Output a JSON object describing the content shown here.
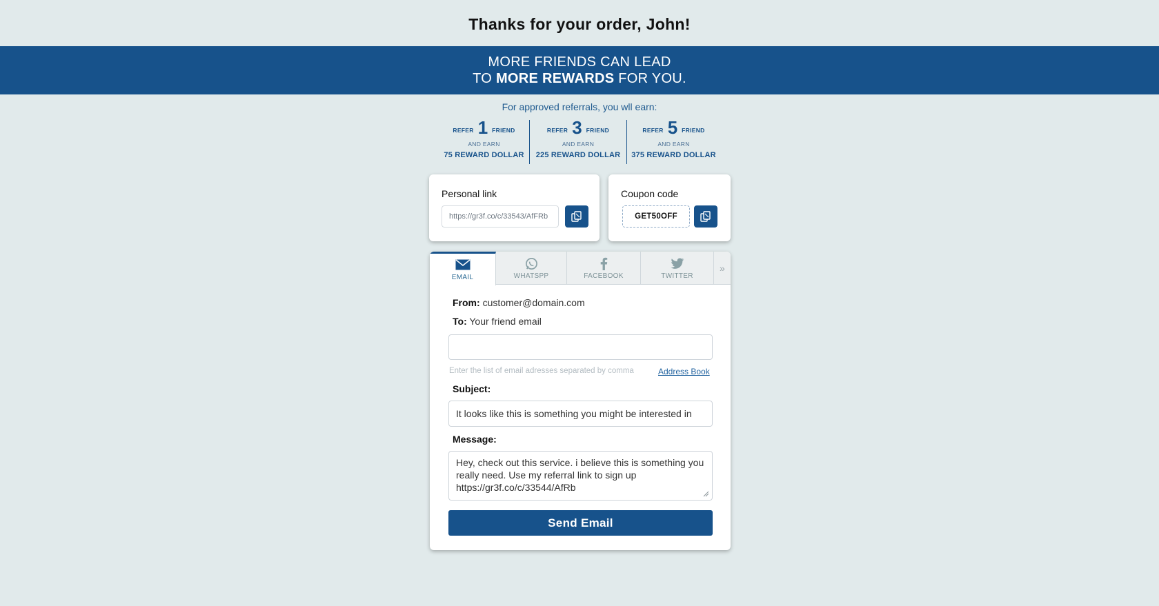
{
  "header": {
    "title": "Thanks for your order, John!"
  },
  "banner": {
    "line1": "MORE FRIENDS CAN LEAD",
    "line2_prefix": "TO ",
    "line2_bold": "MORE REWARDS",
    "line2_suffix": " FOR YOU."
  },
  "rewards": {
    "note": "For approved referrals, you wll earn:",
    "tiers": [
      {
        "refer": "REFER",
        "count": "1",
        "friend": "FRIEND",
        "and_earn": "AND EARN",
        "reward": "75 REWARD DOLLAR"
      },
      {
        "refer": "REFER",
        "count": "3",
        "friend": "FRIEND",
        "and_earn": "AND EARN",
        "reward": "225 REWARD DOLLAR"
      },
      {
        "refer": "REFER",
        "count": "5",
        "friend": "FRIEND",
        "and_earn": "AND EARN",
        "reward": "375 REWARD DOLLAR"
      }
    ]
  },
  "personal_link": {
    "label": "Personal link",
    "value": "https://gr3f.co/c/33543/AfFRb",
    "copy_icon": "copy-icon"
  },
  "coupon": {
    "label": "Coupon code",
    "code": "GET50OFF",
    "copy_icon": "copy-icon"
  },
  "tabs": [
    {
      "label": "EMAIL",
      "icon": "envelope-icon",
      "active": true
    },
    {
      "label": "WHATSPP",
      "icon": "whatsapp-icon",
      "active": false
    },
    {
      "label": "FACEBOOK",
      "icon": "facebook-icon",
      "active": false
    },
    {
      "label": "TWITTER",
      "icon": "twitter-icon",
      "active": false
    },
    {
      "label": "»",
      "icon": "chevron-double-right-icon",
      "active": false
    }
  ],
  "email_form": {
    "from_label": "From:",
    "from_value": "customer@domain.com",
    "to_label": "To:",
    "to_value": "Your friend email",
    "to_input_value": "",
    "hint": "Enter the list of email adresses separated by comma",
    "address_book": "Address Book",
    "subject_label": "Subject:",
    "subject_value": "It looks like this is something you might be interested in",
    "message_label": "Message:",
    "message_value": "Hey, check out this service. i believe this is something you really need. Use my referral link to sign up https://gr3f.co/c/33544/AfRb",
    "send_label": "Send Email"
  },
  "colors": {
    "primary": "#17528b",
    "background": "#e1eaeb",
    "link": "#2364a0"
  }
}
